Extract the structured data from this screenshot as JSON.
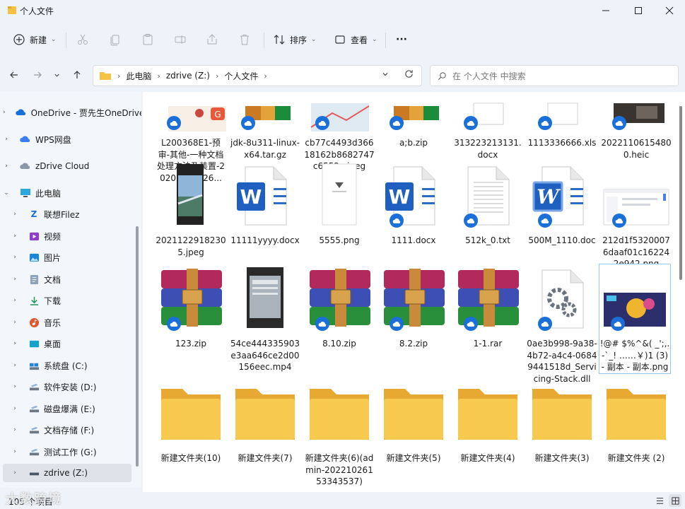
{
  "window": {
    "title": "个人文件",
    "colors": {
      "accent": "#1a6fd8",
      "folder": "#f6c244"
    }
  },
  "toolbar": {
    "new_label": "新建",
    "sort_label": "排序",
    "view_label": "查看",
    "more_label": "···"
  },
  "address": {
    "crumbs": [
      "此电脑",
      "zdrive (Z:)",
      "个人文件"
    ]
  },
  "search": {
    "placeholder": "在 个人文件 中搜索"
  },
  "sidebar": {
    "items": [
      {
        "label": "OneDrive - 贾先生OneDrive",
        "icon": "onedrive-cloud-icon"
      },
      {
        "label": "WPS网盘",
        "icon": "wps-cloud-icon"
      },
      {
        "label": "zDrive Cloud",
        "icon": "zdrive-cloud-icon"
      },
      {
        "label": "此电脑",
        "icon": "computer-icon"
      },
      {
        "label": "联想Filez",
        "icon": "filez-icon"
      },
      {
        "label": "视频",
        "icon": "video-icon"
      },
      {
        "label": "图片",
        "icon": "pictures-icon"
      },
      {
        "label": "文档",
        "icon": "documents-icon"
      },
      {
        "label": "下载",
        "icon": "download-icon"
      },
      {
        "label": "音乐",
        "icon": "music-icon"
      },
      {
        "label": "桌面",
        "icon": "desktop-icon"
      },
      {
        "label": "系统盘 (C:)",
        "icon": "system-drive-icon"
      },
      {
        "label": "软件安装 (D:)",
        "icon": "drive-icon"
      },
      {
        "label": "磁盘爆满 (E:)",
        "icon": "drive-icon"
      },
      {
        "label": "文档存储 (F:)",
        "icon": "drive-icon"
      },
      {
        "label": "测试工作 (G:)",
        "icon": "drive-icon"
      },
      {
        "label": "zdrive (Z:)",
        "icon": "drive-icon"
      }
    ]
  },
  "files": {
    "row1": [
      {
        "label": "L200368E1-预审-其他-一种文档处理方法及装置-20201108126...",
        "type": "image-doc"
      },
      {
        "label": "jdk-8u311-linux-x64.tar.gz",
        "type": "archive"
      },
      {
        "label": "cb77c4493d36618162b8682747c6552e.jpeg",
        "type": "image-map"
      },
      {
        "label": "a;b.zip",
        "type": "archive"
      },
      {
        "label": "313223213131.docx",
        "type": "doc"
      },
      {
        "label": "1113336666.xls",
        "type": "doc"
      },
      {
        "label": "20221106154800.heic",
        "type": "image-dark"
      }
    ],
    "row2": [
      {
        "label": "20211229182305.jpeg",
        "type": "photo"
      },
      {
        "label": "11111yyyy.docx",
        "type": "word"
      },
      {
        "label": "5555.png",
        "type": "image-white"
      },
      {
        "label": "1111.docx",
        "type": "word"
      },
      {
        "label": "512k_0.txt",
        "type": "text"
      },
      {
        "label": "500M_1110.doc",
        "type": "word-old"
      },
      {
        "label": "212d1f53200076daaf01c162242e942.png",
        "type": "screenshot"
      }
    ],
    "row3": [
      {
        "label": "123.zip",
        "type": "rar"
      },
      {
        "label": "54ce444335903e3aa646ce2d00156eec.mp4",
        "type": "video"
      },
      {
        "label": "8.10.zip",
        "type": "rar"
      },
      {
        "label": "8.2.zip",
        "type": "rar"
      },
      {
        "label": "1-1.rar",
        "type": "rar"
      },
      {
        "label": "0ae3b998-9a38-4b72-a4c4-06849441518d_Servicing-Stack.dll",
        "type": "dll"
      },
      {
        "label": "!@# $%^&( _';,.-`_! ……￥)1 (3) - 副本 - 副本.png",
        "type": "art"
      }
    ],
    "row4": [
      {
        "label": "新建文件夹(10)",
        "type": "folder"
      },
      {
        "label": "新建文件夹(7)",
        "type": "folder"
      },
      {
        "label": "新建文件夹(6)(admin-20221026153343537)",
        "type": "folder"
      },
      {
        "label": "新建文件夹(5)",
        "type": "folder"
      },
      {
        "label": "新建文件夹(4)",
        "type": "folder"
      },
      {
        "label": "新建文件夹(3)",
        "type": "folder"
      },
      {
        "label": "新建文件夹 (2)",
        "type": "folder"
      }
    ]
  },
  "status": {
    "count": "105 个项目",
    "watermark": "大数跨境"
  }
}
